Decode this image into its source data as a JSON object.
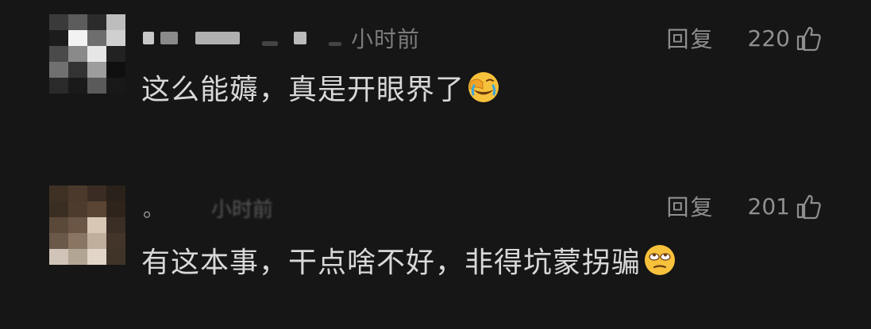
{
  "comments": [
    {
      "time": "小时前",
      "reply_label": "回复",
      "likes": "220",
      "text": "这么能薅，真是开眼界了",
      "emoji_icon": "facepalm-laughing-icon"
    },
    {
      "author_partial": "。",
      "time_partial": "小时前",
      "reply_label": "回复",
      "likes": "201",
      "text": "有这本事，干点啥不好，非得坑蒙拐骗",
      "emoji_icon": "eye-roll-icon"
    }
  ],
  "colors": {
    "background": "#161616",
    "text_primary": "#d8d8d8",
    "text_secondary": "#8f8f8f",
    "emoji_yellow": "#f7c23b"
  }
}
